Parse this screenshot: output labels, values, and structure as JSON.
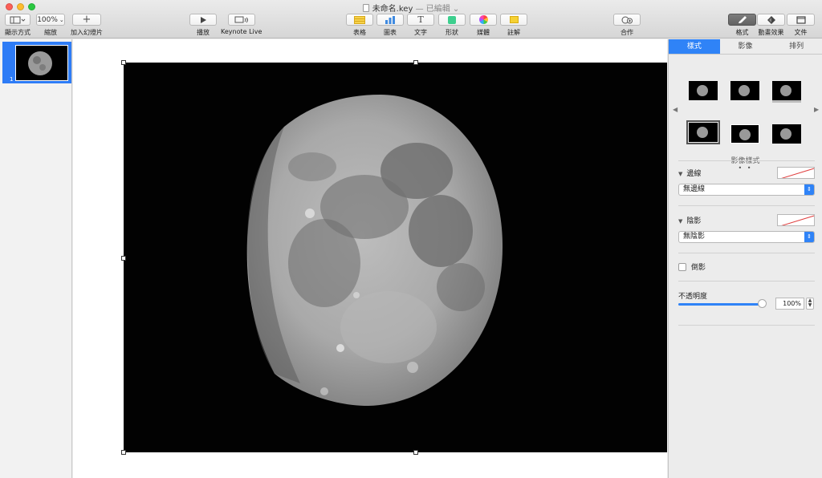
{
  "window": {
    "title": "未命名.key",
    "separator": "—",
    "status": "已編輯"
  },
  "toolbar": {
    "view_label": "顯示方式",
    "zoom_value": "100%",
    "zoom_label": "縮放",
    "add_slide_label": "加入幻燈片",
    "play_label": "播放",
    "keynote_live_label": "Keynote Live",
    "table_label": "表格",
    "chart_label": "圖表",
    "text_label": "文字",
    "shape_label": "形狀",
    "media_label": "媒體",
    "comment_label": "註解",
    "collaborate_label": "合作",
    "format_label": "格式",
    "animate_label": "動畫效果",
    "document_label": "文件"
  },
  "navigator": {
    "slides": [
      {
        "number": "1"
      }
    ]
  },
  "inspector": {
    "tabs": [
      "樣式",
      "影像",
      "排列"
    ],
    "active_tab": "樣式",
    "image_styles_label": "影像樣式",
    "border": {
      "label": "邊線",
      "value": "無邊線"
    },
    "shadow": {
      "label": "陰影",
      "value": "無陰影"
    },
    "reflection": {
      "label": "倒影",
      "checked": false
    },
    "opacity": {
      "label": "不透明度",
      "value": "100%",
      "level": 1.0
    }
  },
  "colors": {
    "accent": "#2f83f7",
    "selection": "#2e7cf6",
    "canvas": "#ffffff"
  }
}
